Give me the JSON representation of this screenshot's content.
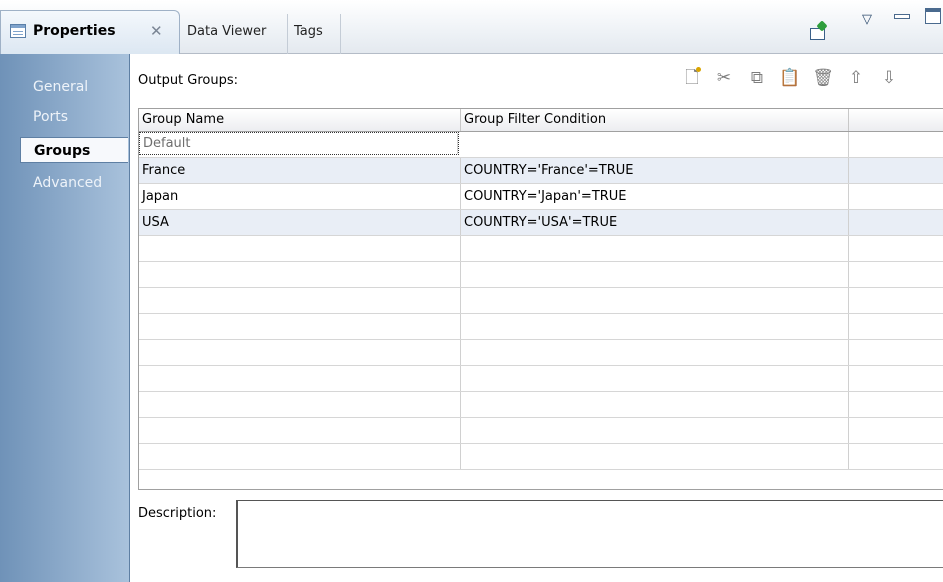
{
  "tabs": {
    "active": {
      "label": "Properties",
      "close_glyph": "✕",
      "icon": "table-icon"
    },
    "others": [
      {
        "label": "Data Viewer"
      },
      {
        "label": "Tags"
      }
    ],
    "controls": {
      "pin_icon": "pin-new-icon",
      "menu_glyph": "▽",
      "min_icon": "minimize-icon",
      "max_icon": "maximize-icon"
    }
  },
  "sidenav": {
    "items": [
      {
        "label": "General",
        "selected": false
      },
      {
        "label": "Ports",
        "selected": false
      },
      {
        "label": "Groups",
        "selected": true
      },
      {
        "label": "Advanced",
        "selected": false
      }
    ]
  },
  "main": {
    "output_groups_label": "Output Groups:",
    "toolbar": {
      "new_glyph": "🗋",
      "cut_glyph": "✂",
      "copy_glyph": "⧉",
      "paste_glyph": "📋",
      "delete_glyph": "🗑",
      "up_glyph": "⇧",
      "down_glyph": "⇩"
    },
    "grid": {
      "columns": [
        "Group Name",
        "Group Filter Condition",
        ""
      ],
      "rows": [
        {
          "name": "Default",
          "condition": ""
        },
        {
          "name": "France",
          "condition": "COUNTRY='France'=TRUE"
        },
        {
          "name": "Japan",
          "condition": "COUNTRY='Japan'=TRUE"
        },
        {
          "name": "USA",
          "condition": "COUNTRY='USA'=TRUE"
        }
      ]
    },
    "description_label": "Description:",
    "description_value": ""
  }
}
